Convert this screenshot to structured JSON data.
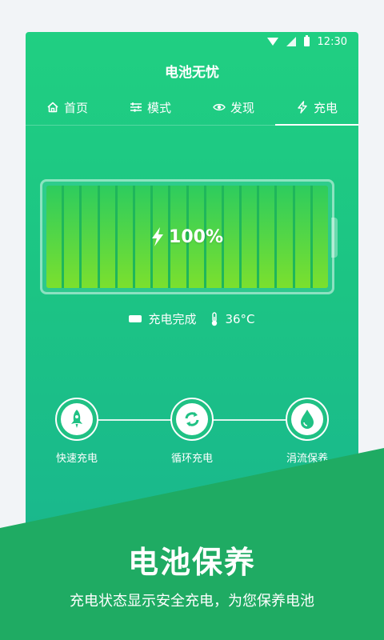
{
  "status_bar": {
    "time": "12:30"
  },
  "app": {
    "title": "电池无忧"
  },
  "tabs": [
    {
      "label": "首页",
      "icon": "home-icon",
      "active": false
    },
    {
      "label": "模式",
      "icon": "sliders-icon",
      "active": false
    },
    {
      "label": "发现",
      "icon": "eye-icon",
      "active": false
    },
    {
      "label": "充电",
      "icon": "lightning-icon",
      "active": true
    }
  ],
  "battery": {
    "level_text": "100%",
    "level": 100,
    "fill_color": "#6edc2e"
  },
  "charge_info": {
    "status": "充电完成",
    "temperature": "36°C"
  },
  "modes": [
    {
      "label": "快速充电",
      "icon": "rocket-icon"
    },
    {
      "label": "循环充电",
      "icon": "cycle-icon"
    },
    {
      "label": "涓流保养",
      "icon": "drop-icon"
    }
  ],
  "banner": {
    "title": "电池保养",
    "subtitle": "充电状态显示安全充电，为您保养电池"
  },
  "colors": {
    "primary": "#20cf82",
    "banner": "#1fab63"
  }
}
